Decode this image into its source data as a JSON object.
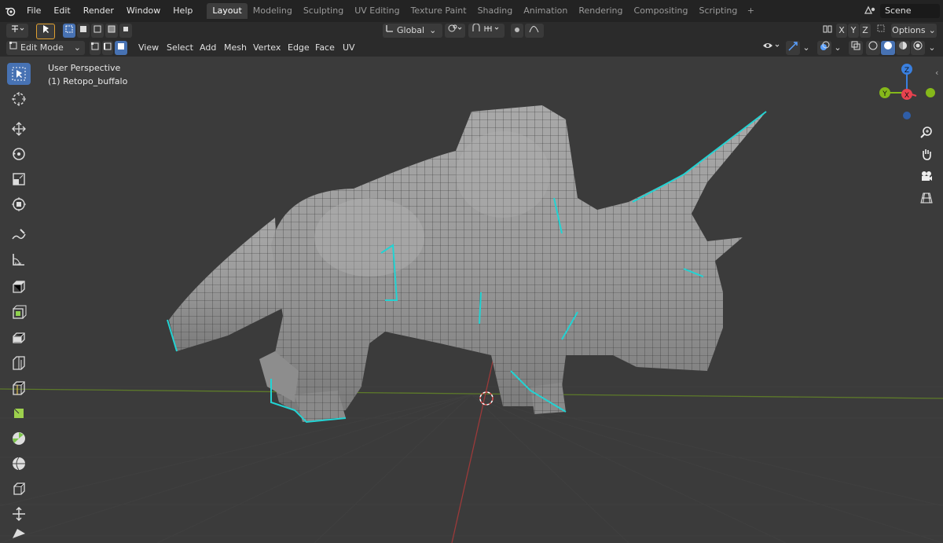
{
  "menu": {
    "file": "File",
    "edit": "Edit",
    "render": "Render",
    "window": "Window",
    "help": "Help"
  },
  "workspaces": [
    "Layout",
    "Modeling",
    "Sculpting",
    "UV Editing",
    "Texture Paint",
    "Shading",
    "Animation",
    "Rendering",
    "Compositing",
    "Scripting"
  ],
  "workspace_add": "+",
  "scene": {
    "name": "Scene"
  },
  "header": {
    "orientation": "Global",
    "axes": {
      "x": "X",
      "y": "Y",
      "z": "Z"
    },
    "options": "Options"
  },
  "editmode": {
    "mode": "Edit Mode",
    "menus": [
      "View",
      "Select",
      "Add",
      "Mesh",
      "Vertex",
      "Edge",
      "Face",
      "UV"
    ]
  },
  "viewport": {
    "perspective": "User Perspective",
    "object": "(1) Retopo_buffalo"
  },
  "gizmo": {
    "z": "Z",
    "y": "Y",
    "x": "X"
  },
  "colors": {
    "accent": "#4772b3",
    "x_axis": "#e8424f",
    "y_axis": "#85b81a",
    "z_axis": "#3a80e0",
    "seam": "#22d3d3"
  }
}
